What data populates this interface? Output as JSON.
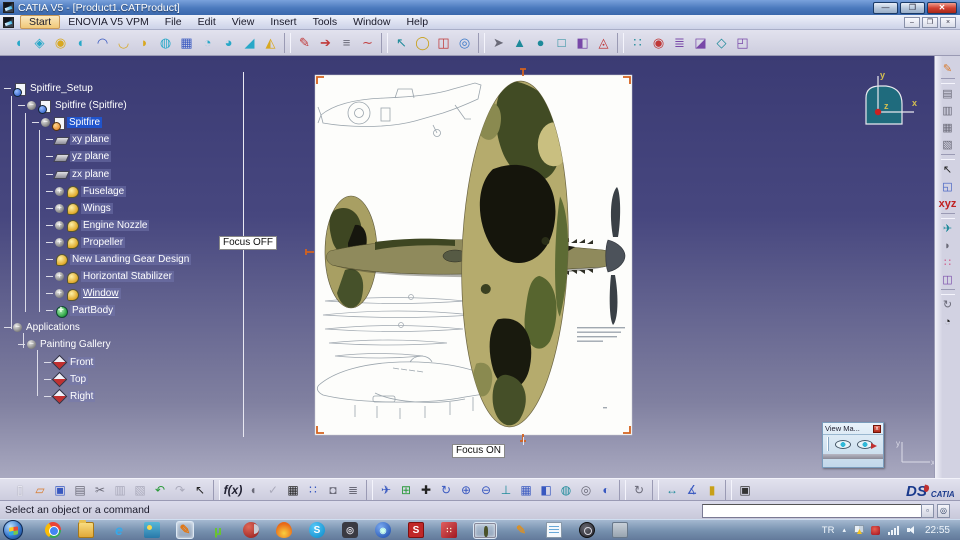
{
  "window": {
    "title": "CATIA V5 - [Product1.CATProduct]"
  },
  "window_controls": {
    "minimize": "—",
    "restore": "❐",
    "close": "✕"
  },
  "mdi_controls": {
    "minimize": "–",
    "restore": "❐",
    "close": "×"
  },
  "menu": {
    "items": [
      {
        "label": "Start",
        "active": true,
        "name": "menu-start"
      },
      {
        "label": "ENOVIA V5 VPM",
        "name": "menu-enovia"
      },
      {
        "label": "File",
        "name": "menu-file"
      },
      {
        "label": "Edit",
        "name": "menu-edit"
      },
      {
        "label": "View",
        "name": "menu-view"
      },
      {
        "label": "Insert",
        "name": "menu-insert"
      },
      {
        "label": "Tools",
        "name": "menu-tools"
      },
      {
        "label": "Window",
        "name": "menu-window"
      },
      {
        "label": "Help",
        "name": "menu-help"
      }
    ]
  },
  "top_toolbar": {
    "icons": [
      {
        "name": "freestyle-patch-icon",
        "glyph": "◖",
        "cls": "cyn"
      },
      {
        "name": "control-points-icon",
        "glyph": "◈",
        "cls": "cyn"
      },
      {
        "name": "freestyle-extrude-icon",
        "glyph": "◉",
        "cls": "yel"
      },
      {
        "name": "freestyle-offset-icon",
        "glyph": "◐",
        "cls": "cyn"
      },
      {
        "name": "styling-sweep-icon",
        "glyph": "◠",
        "cls": "blu"
      },
      {
        "name": "freestyle-curve-icon",
        "glyph": "◡",
        "cls": "yel"
      },
      {
        "name": "arc-icon",
        "glyph": "◗",
        "cls": "yel"
      },
      {
        "name": "fill-surface-icon",
        "glyph": "◍",
        "cls": "cyn"
      },
      {
        "name": "net-surface-icon",
        "glyph": "▦",
        "cls": "blu"
      },
      {
        "name": "blend-surface-icon",
        "glyph": "◔",
        "cls": "cyn"
      },
      {
        "name": "match-surface-icon",
        "glyph": "◕",
        "cls": "cyn"
      },
      {
        "name": "extend-surface-icon",
        "glyph": "◢",
        "cls": "cyn"
      },
      {
        "name": "break-surface-icon",
        "glyph": "◭",
        "cls": "yel"
      },
      {
        "sep": true
      },
      {
        "name": "paint-analysis-icon",
        "glyph": "✎",
        "cls": "red"
      },
      {
        "name": "draft-analysis-icon",
        "glyph": "➔",
        "cls": "red"
      },
      {
        "name": "hatching-analysis-icon",
        "glyph": "≡",
        "cls": "gry"
      },
      {
        "name": "curvature-comb-icon",
        "glyph": "∼",
        "cls": "red"
      },
      {
        "sep": true
      },
      {
        "name": "sketch-tracer-icon",
        "glyph": "↖",
        "cls": "tea"
      },
      {
        "name": "ellipse-tool-icon",
        "glyph": "◯",
        "cls": "yelc"
      },
      {
        "name": "immersive-cube-icon",
        "glyph": "◫",
        "cls": "red"
      },
      {
        "name": "magnifier-icon",
        "glyph": "◎",
        "cls": "mag"
      },
      {
        "sep": true
      },
      {
        "name": "pointer-tool-icon",
        "glyph": "➤",
        "cls": "gry"
      },
      {
        "name": "cone-view-icon",
        "glyph": "▲",
        "cls": "tea"
      },
      {
        "name": "sphere-tool-icon",
        "glyph": "●",
        "cls": "tea"
      },
      {
        "name": "plane-frame-icon",
        "glyph": "□",
        "cls": "tea"
      },
      {
        "name": "split-shape-icon",
        "glyph": "◧",
        "cls": "vio"
      },
      {
        "name": "rotate-shape-icon",
        "glyph": "◬",
        "cls": "red"
      },
      {
        "sep": true
      },
      {
        "name": "spheres-pair-icon",
        "glyph": "∷",
        "cls": "tea"
      },
      {
        "name": "red-sphere-icon",
        "glyph": "◉",
        "cls": "red"
      },
      {
        "name": "layers-stack-icon",
        "glyph": "≣",
        "cls": "vio"
      },
      {
        "name": "purple-cube-icon",
        "glyph": "◪",
        "cls": "vio"
      },
      {
        "name": "stamp-icon",
        "glyph": "◇",
        "cls": "tea"
      },
      {
        "name": "box-3d-icon",
        "glyph": "◰",
        "cls": "vio"
      }
    ]
  },
  "right_toolbar": {
    "icons": [
      {
        "name": "paint-surface-icon",
        "glyph": "✎",
        "cls": "ora"
      },
      {
        "sep": true
      },
      {
        "name": "catalog-browser-icon",
        "glyph": "▤",
        "cls": "gry"
      },
      {
        "name": "photo-studio-icon",
        "glyph": "▥",
        "cls": "gry"
      },
      {
        "name": "render-shot-icon",
        "glyph": "▦",
        "cls": "gry"
      },
      {
        "name": "album-icon",
        "glyph": "▧",
        "cls": "gry"
      },
      {
        "sep": true
      },
      {
        "name": "select-arrow-icon",
        "glyph": "↖",
        "cls": "blk"
      },
      {
        "name": "select-box-icon",
        "glyph": "◱",
        "cls": "blu"
      },
      {
        "name": "xyz-axis-icon",
        "glyph": "xyz",
        "cls": "xyz"
      },
      {
        "sep": true
      },
      {
        "name": "fly-mode-icon",
        "glyph": "✈",
        "cls": "tea"
      },
      {
        "name": "mouse-sim-icon",
        "glyph": "◗",
        "cls": "gry"
      },
      {
        "name": "molecule-icon",
        "glyph": "∷",
        "cls": "pnk"
      },
      {
        "name": "view-cube-icon",
        "glyph": "◫",
        "cls": "vio"
      },
      {
        "sep": true
      },
      {
        "name": "update-icon",
        "glyph": "↻",
        "cls": "gry"
      },
      {
        "name": "compass-disk-icon",
        "glyph": "◔",
        "cls": "blk"
      }
    ]
  },
  "bottom_toolbar": {
    "icons": [
      {
        "name": "new-document-icon",
        "glyph": "▯",
        "cls": "wht"
      },
      {
        "name": "open-icon",
        "glyph": "▱",
        "cls": "ora"
      },
      {
        "name": "save-icon",
        "glyph": "▣",
        "cls": "blu"
      },
      {
        "name": "print-icon",
        "glyph": "▤",
        "cls": "gry"
      },
      {
        "name": "cut-icon",
        "glyph": "✂",
        "cls": "gry"
      },
      {
        "name": "copy-icon",
        "glyph": "▥",
        "cls": "dis"
      },
      {
        "name": "paste-icon",
        "glyph": "▧",
        "cls": "dis"
      },
      {
        "name": "undo-icon",
        "glyph": "↶",
        "cls": "grn"
      },
      {
        "name": "redo-icon",
        "glyph": "↷",
        "cls": "dis"
      },
      {
        "name": "whats-this-icon",
        "glyph": "↖",
        "cls": "blk"
      },
      {
        "sep": true
      },
      {
        "name": "fx-formula-icon",
        "glyph": "f(x)",
        "cls": "fx"
      },
      {
        "name": "comment-icon",
        "glyph": "◖",
        "cls": "gry"
      },
      {
        "name": "check-rule-icon",
        "glyph": "✓",
        "cls": "dis"
      },
      {
        "name": "design-table-icon",
        "glyph": "▦",
        "cls": "blk"
      },
      {
        "name": "graph-tree-icon",
        "glyph": "∷",
        "cls": "blu"
      },
      {
        "name": "lock-icon",
        "glyph": "◘",
        "cls": "gry"
      },
      {
        "name": "list-edit-icon",
        "glyph": "≣",
        "cls": "gry"
      },
      {
        "sep": true
      },
      {
        "name": "fly-icon",
        "glyph": "✈",
        "cls": "blu"
      },
      {
        "name": "fit-all-icon",
        "glyph": "⊞",
        "cls": "grn"
      },
      {
        "name": "pan-icon",
        "glyph": "✚",
        "cls": "blk"
      },
      {
        "name": "rotate-icon",
        "glyph": "↻",
        "cls": "blu"
      },
      {
        "name": "zoom-in-icon",
        "glyph": "⊕",
        "cls": "blu"
      },
      {
        "name": "zoom-out-icon",
        "glyph": "⊖",
        "cls": "blu"
      },
      {
        "name": "normal-view-icon",
        "glyph": "⊥",
        "cls": "tea"
      },
      {
        "name": "multi-view-icon",
        "glyph": "▦",
        "cls": "blu"
      },
      {
        "name": "iso-view-icon",
        "glyph": "◧",
        "cls": "blu"
      },
      {
        "name": "shaded-view-icon",
        "glyph": "◍",
        "cls": "tea"
      },
      {
        "name": "wireframe-view-icon",
        "glyph": "◎",
        "cls": "gry"
      },
      {
        "name": "hide-show-icon",
        "glyph": "◐",
        "cls": "blu"
      },
      {
        "sep": true
      },
      {
        "name": "turntable-icon",
        "glyph": "↻",
        "cls": "gry"
      },
      {
        "sep": true
      },
      {
        "name": "measure-between-icon",
        "glyph": "↔",
        "cls": "tea"
      },
      {
        "name": "measure-item-icon",
        "glyph": "∡",
        "cls": "blu"
      },
      {
        "name": "measure-inertia-icon",
        "glyph": "▮",
        "cls": "yelc"
      },
      {
        "sep": true
      },
      {
        "name": "camera-capture-icon",
        "glyph": "▣",
        "cls": "cam"
      }
    ]
  },
  "tree": {
    "items": [
      {
        "label": "Spitfire_Setup",
        "cls": "d0 ic-product",
        "exp": "",
        "name": "tree-item-spitfire-setup"
      },
      {
        "label": "Spitfire (Spitfire)",
        "cls": "d1 ic-product",
        "exp": "−",
        "name": "tree-item-spitfire-spitfire"
      },
      {
        "label": "Spitfire",
        "cls": "d2 ic-part sel",
        "exp": "−",
        "name": "tree-item-spitfire"
      },
      {
        "label": "xy plane",
        "cls": "d3 ic-plane hl",
        "exp": "",
        "name": "tree-item-xy-plane"
      },
      {
        "label": "yz plane",
        "cls": "d3 ic-plane hl",
        "exp": "",
        "name": "tree-item-yz-plane"
      },
      {
        "label": "zx plane",
        "cls": "d3 ic-plane hl",
        "exp": "",
        "name": "tree-item-zx-plane"
      },
      {
        "label": "Fuselage",
        "cls": "d3 ic-geo hl",
        "exp": "+",
        "name": "tree-item-fuselage"
      },
      {
        "label": "Wings",
        "cls": "d3 ic-geo hl",
        "exp": "+",
        "name": "tree-item-wings"
      },
      {
        "label": "Engine Nozzle",
        "cls": "d3 ic-geo hl",
        "exp": "+",
        "name": "tree-item-engine-nozzle"
      },
      {
        "label": "Propeller",
        "cls": "d3 ic-geo hl",
        "exp": "+",
        "name": "tree-item-propeller"
      },
      {
        "label": "New Landing Gear Design",
        "cls": "d3 ic-geo hl",
        "exp": "",
        "name": "tree-item-new-landing-gear-design"
      },
      {
        "label": "Horizontal Stabilizer",
        "cls": "d3 ic-geo hl",
        "exp": "+",
        "name": "tree-item-horizontal-stabilizer"
      },
      {
        "label": "Window",
        "cls": "d3 ic-geo hl und",
        "exp": "+",
        "name": "tree-item-window"
      },
      {
        "label": "PartBody",
        "cls": "d3 ic-body hl",
        "exp": "",
        "name": "tree-item-partbody"
      },
      {
        "label": "Applications",
        "cls": "d0 noicon",
        "exp": "−",
        "name": "tree-item-applications"
      },
      {
        "label": "Painting Gallery",
        "cls": "d1 noicon",
        "exp": "−",
        "name": "tree-item-painting-gallery"
      },
      {
        "label": "Front",
        "cls": "d2f ic-paint hl",
        "exp": "",
        "name": "tree-item-front"
      },
      {
        "label": "Top",
        "cls": "d2f ic-paint hl",
        "exp": "",
        "name": "tree-item-top"
      },
      {
        "label": "Right",
        "cls": "d2f ic-paint hl",
        "exp": "",
        "name": "tree-item-right"
      }
    ]
  },
  "viewport": {
    "focus_off": "Focus OFF",
    "focus_on": "Focus ON"
  },
  "compass": {
    "x": "x",
    "y": "y",
    "z": "z"
  },
  "mini_axis": {
    "x": "x",
    "y": "y"
  },
  "view_palette": {
    "title": "View Ma...",
    "close": "x"
  },
  "status": {
    "message": "Select an object or a command",
    "input_value": ""
  },
  "logo": {
    "ds": "DS",
    "catia": "CATIA"
  },
  "taskbar": {
    "lang": "TR",
    "chevron": "▴",
    "time": "22:55",
    "apps": [
      {
        "name": "taskbar-chrome-icon",
        "cls": "a-chrome",
        "glyph": ""
      },
      {
        "name": "taskbar-explorer-icon",
        "cls": "a-folder",
        "glyph": ""
      },
      {
        "name": "taskbar-ie-icon",
        "cls": "a-ie",
        "glyph": "e"
      },
      {
        "name": "taskbar-photos-icon",
        "cls": "a-photos",
        "glyph": ""
      },
      {
        "name": "taskbar-catia-icon",
        "cls": "a-catia",
        "glyph": "✎",
        "active": true
      },
      {
        "name": "taskbar-utorrent-icon",
        "cls": "a-ut",
        "glyph": "µ"
      },
      {
        "name": "taskbar-ccleaner-icon",
        "cls": "a-cc",
        "glyph": ""
      },
      {
        "name": "taskbar-flame-icon",
        "cls": "a-flame",
        "glyph": ""
      },
      {
        "name": "taskbar-skype-icon",
        "cls": "a-skype",
        "glyph": "S"
      },
      {
        "name": "taskbar-dark-app-icon",
        "cls": "a-dark",
        "glyph": "◎"
      },
      {
        "name": "taskbar-blue-app-icon",
        "cls": "a-blue",
        "glyph": "◉"
      },
      {
        "name": "taskbar-s-red-icon",
        "cls": "a-sred",
        "glyph": "S"
      },
      {
        "name": "taskbar-red-app-icon",
        "cls": "a-red3d",
        "glyph": "∷"
      },
      {
        "name": "taskbar-active-window",
        "cls": "a-thumb",
        "glyph": "",
        "active": true
      },
      {
        "name": "taskbar-pencil-icon",
        "cls": "a-pencil",
        "glyph": "✎"
      },
      {
        "name": "taskbar-notepad-icon",
        "cls": "a-notepad",
        "glyph": ""
      },
      {
        "name": "taskbar-volume-app-icon",
        "cls": "a-volume",
        "glyph": ""
      },
      {
        "name": "taskbar-gray-app-icon",
        "cls": "a-gray",
        "glyph": ""
      }
    ]
  }
}
